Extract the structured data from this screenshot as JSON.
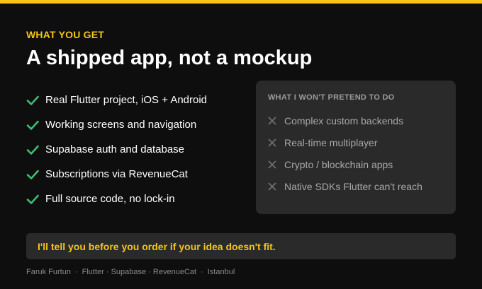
{
  "colors": {
    "background": "#0e0e0e",
    "accent": "#f5c518",
    "check": "#3dbf74",
    "card": "#2a2a2a",
    "muted": "#a8a8a8"
  },
  "header": {
    "eyebrow": "WHAT YOU GET",
    "title": "A shipped app, not a mockup"
  },
  "features": {
    "icon": "check-icon",
    "items": [
      "Real Flutter project, iOS + Android",
      "Working screens and navigation",
      "Supabase auth and database",
      "Subscriptions via RevenueCat",
      "Full source code, no lock-in"
    ]
  },
  "exclusions": {
    "title": "WHAT I WON'T PRETEND TO DO",
    "icon": "cross-icon",
    "items": [
      "Complex custom backends",
      "Real-time multiplayer",
      "Crypto / blockchain apps",
      "Native SDKs Flutter can't reach"
    ]
  },
  "notice": {
    "text": "I'll tell you before you order if your idea doesn't fit."
  },
  "footer": {
    "name": "Faruk Furtun",
    "stack": "Flutter · Supabase · RevenueCat",
    "location": "Istanbul",
    "separator": "·"
  }
}
